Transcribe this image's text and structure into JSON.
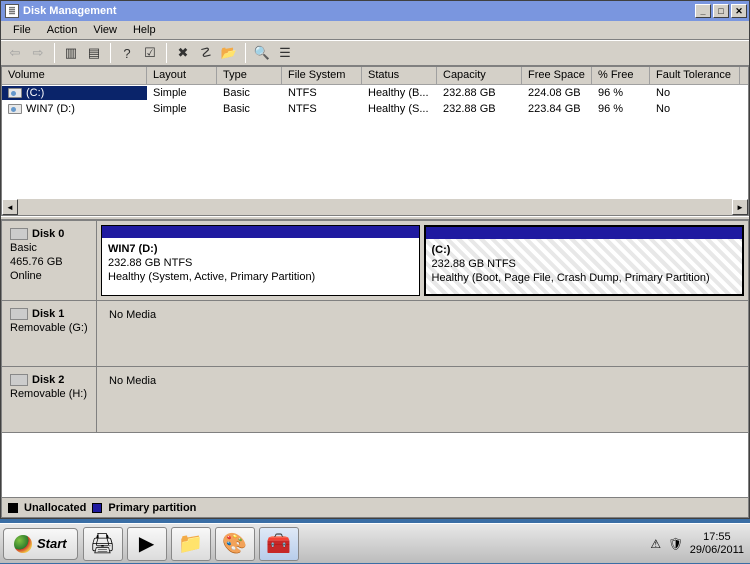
{
  "window": {
    "title": "Disk Management",
    "buttons": {
      "min": "_",
      "max": "□",
      "close": "✕"
    }
  },
  "menubar": [
    "File",
    "Action",
    "View",
    "Help"
  ],
  "toolbar_icons": [
    {
      "name": "back-icon",
      "glyph": "⇦",
      "disabled": true
    },
    {
      "name": "forward-icon",
      "glyph": "⇨",
      "disabled": true
    },
    {
      "sep": true
    },
    {
      "name": "up-icon",
      "glyph": "▥"
    },
    {
      "name": "tree-icon",
      "glyph": "▤"
    },
    {
      "sep": true
    },
    {
      "name": "refresh-icon",
      "glyph": "?"
    },
    {
      "name": "settings-icon",
      "glyph": "☑"
    },
    {
      "sep": true
    },
    {
      "name": "delete-icon",
      "glyph": "✖"
    },
    {
      "name": "properties-icon",
      "glyph": "☡"
    },
    {
      "name": "open-icon",
      "glyph": "📂"
    },
    {
      "sep": true
    },
    {
      "name": "search-icon",
      "glyph": "🔍"
    },
    {
      "name": "list-icon",
      "glyph": "☰"
    }
  ],
  "volume_columns": [
    "Volume",
    "Layout",
    "Type",
    "File System",
    "Status",
    "Capacity",
    "Free Space",
    "% Free",
    "Fault Tolerance"
  ],
  "volumes": [
    {
      "name": "(C:)",
      "layout": "Simple",
      "type": "Basic",
      "fs": "NTFS",
      "status": "Healthy (B...",
      "capacity": "232.88 GB",
      "free": "224.08 GB",
      "pct": "96 %",
      "fault": "No",
      "selected": true
    },
    {
      "name": "WIN7 (D:)",
      "layout": "Simple",
      "type": "Basic",
      "fs": "NTFS",
      "status": "Healthy (S...",
      "capacity": "232.88 GB",
      "free": "223.84 GB",
      "pct": "96 %",
      "fault": "No",
      "selected": false
    }
  ],
  "disks": [
    {
      "id": "Disk 0",
      "info1": "Basic",
      "info2": "465.76 GB",
      "info3": "Online",
      "partitions": [
        {
          "title": "WIN7  (D:)",
          "line2": "232.88 GB NTFS",
          "line3": "Healthy (System, Active, Primary Partition)",
          "hatched": false,
          "selected": false
        },
        {
          "title": "(C:)",
          "line2": "232.88 GB NTFS",
          "line3": "Healthy (Boot, Page File, Crash Dump, Primary Partition)",
          "hatched": true,
          "selected": true
        }
      ]
    },
    {
      "id": "Disk 1",
      "info1": "Removable (G:)",
      "nomedia": "No Media"
    },
    {
      "id": "Disk 2",
      "info1": "Removable (H:)",
      "nomedia": "No Media"
    }
  ],
  "legend": [
    {
      "color": "black",
      "label": "Unallocated"
    },
    {
      "color": "blue",
      "label": "Primary partition"
    }
  ],
  "taskbar": {
    "start": "Start",
    "apps": [
      {
        "name": "devices-icon",
        "glyph": "🖨"
      },
      {
        "name": "powershell-icon",
        "glyph": "▶"
      },
      {
        "name": "explorer-icon",
        "glyph": "📁"
      },
      {
        "name": "paint-icon",
        "glyph": "🎨"
      },
      {
        "name": "toolbox-icon",
        "glyph": "🧰",
        "active": true
      }
    ],
    "tray_icons": [
      {
        "name": "network-warning-icon",
        "glyph": "⚠"
      },
      {
        "name": "security-icon",
        "glyph": "🛡"
      }
    ],
    "time": "17:55",
    "date": "29/06/2011"
  }
}
